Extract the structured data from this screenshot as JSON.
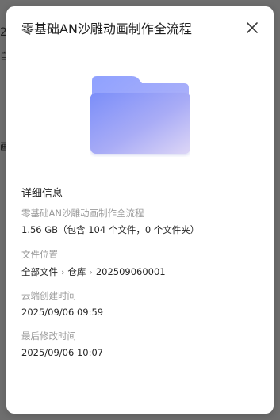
{
  "background": {
    "text_top": "2",
    "text_mid": "画",
    "text_small": "自"
  },
  "panel": {
    "title": "零基础AN沙雕动画制作全流程",
    "close_icon": "close-icon",
    "folder_icon": "folder-icon",
    "details_heading": "详细信息",
    "name_label": "零基础AN沙雕动画制作全流程",
    "size_value": "1.56 GB（包含 104 个文件，0 个文件夹）",
    "location_label": "文件位置",
    "location": {
      "parts": [
        "全部文件",
        "仓库",
        "202509060001"
      ]
    },
    "created_label": "云端创建时间",
    "created_value": "2025/09/06 09:59",
    "modified_label": "最后修改时间",
    "modified_value": "2025/09/06 10:07"
  },
  "colors": {
    "panel_bg": "#ffffff",
    "overlay": "#6f6f6f",
    "folder_light": "#c6c2f3",
    "folder_dark": "#7f8df6"
  }
}
